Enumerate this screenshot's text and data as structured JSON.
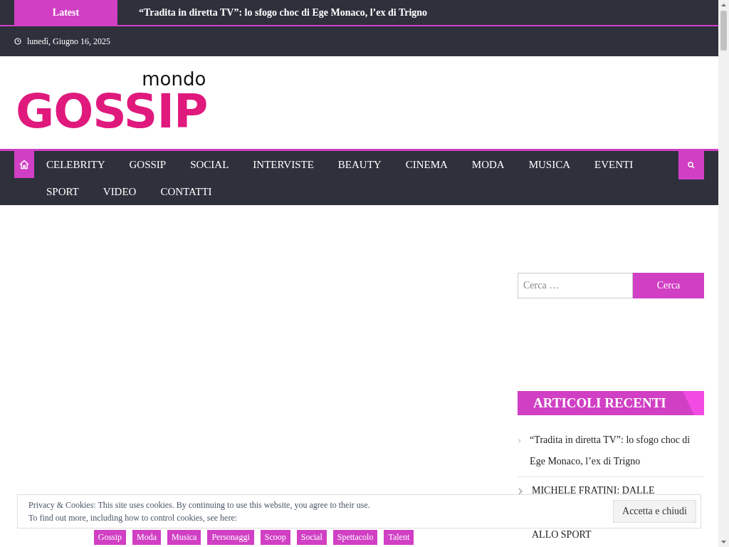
{
  "ticker": {
    "label": "Latest",
    "headline": "“Tradita in diretta TV”: lo sfogo choc di Ege Monaco, l’ex di Trigno"
  },
  "date": "lunedì, Giugno 16, 2025",
  "logo": {
    "top": "mondo",
    "main": "GOSSIP"
  },
  "nav": {
    "items": [
      {
        "label": "CELEBRITY",
        "selected": false
      },
      {
        "label": "GOSSIP",
        "selected": false
      },
      {
        "label": "SOCIAL",
        "selected": false
      },
      {
        "label": "INTERVISTE",
        "selected": false
      },
      {
        "label": "BEAUTY",
        "selected": false
      },
      {
        "label": "CINEMA",
        "selected": false
      },
      {
        "label": "MODA",
        "selected": false
      },
      {
        "label": "MUSICA",
        "selected": false
      },
      {
        "label": "EVENTI",
        "selected": false
      },
      {
        "label": "SPORT",
        "selected": false
      },
      {
        "label": "VIDEO",
        "selected": false
      },
      {
        "label": "CONTATTI",
        "selected": false
      }
    ]
  },
  "search": {
    "placeholder": "Cerca …",
    "button": "Cerca"
  },
  "recent": {
    "title": "ARTICOLI RECENTI",
    "items": [
      {
        "text": "“Tradita in diretta TV”: lo sfogo choc di Ege Monaco, l’ex di Trigno"
      },
      {
        "text": "MICHELE FRATINI: DALLE",
        "continued": "ALLO SPORT"
      }
    ]
  },
  "tags": [
    "Gossip",
    "Moda",
    "Musica",
    "Personaggi",
    "Scoop",
    "Social",
    "Spettacolo",
    "Talent"
  ],
  "cookie": {
    "lines": [
      "Privacy & Cookies: This site uses cookies. By continuing to use this website, you agree to their use.",
      "To find out more, including how to control cookies, see here:"
    ],
    "button": "Accetta e chiudi"
  }
}
